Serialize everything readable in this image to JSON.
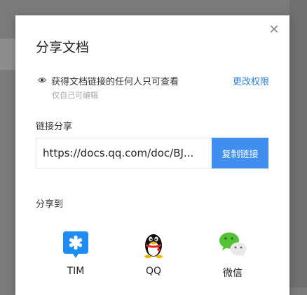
{
  "dialog": {
    "title": "分享文档",
    "close_icon": "close-icon"
  },
  "permission": {
    "icon": "eye-icon",
    "text": "获得文档链接的任何人只可查看",
    "change_link": "更改权限",
    "subtext": "仅自己可编辑"
  },
  "link_share": {
    "label": "链接分享",
    "url": "https://docs.qq.com/doc/BJ...",
    "copy_button": "复制链接",
    "button_color": "#3f8ef0"
  },
  "share_to": {
    "label": "分享到",
    "targets": [
      {
        "label": "TIM",
        "icon": "tim-icon",
        "color": "#1e8cf0"
      },
      {
        "label": "QQ",
        "icon": "qq-penguin-icon",
        "color": "#000000"
      },
      {
        "label": "微信",
        "icon": "wechat-icon",
        "color": "#53c234"
      }
    ]
  }
}
